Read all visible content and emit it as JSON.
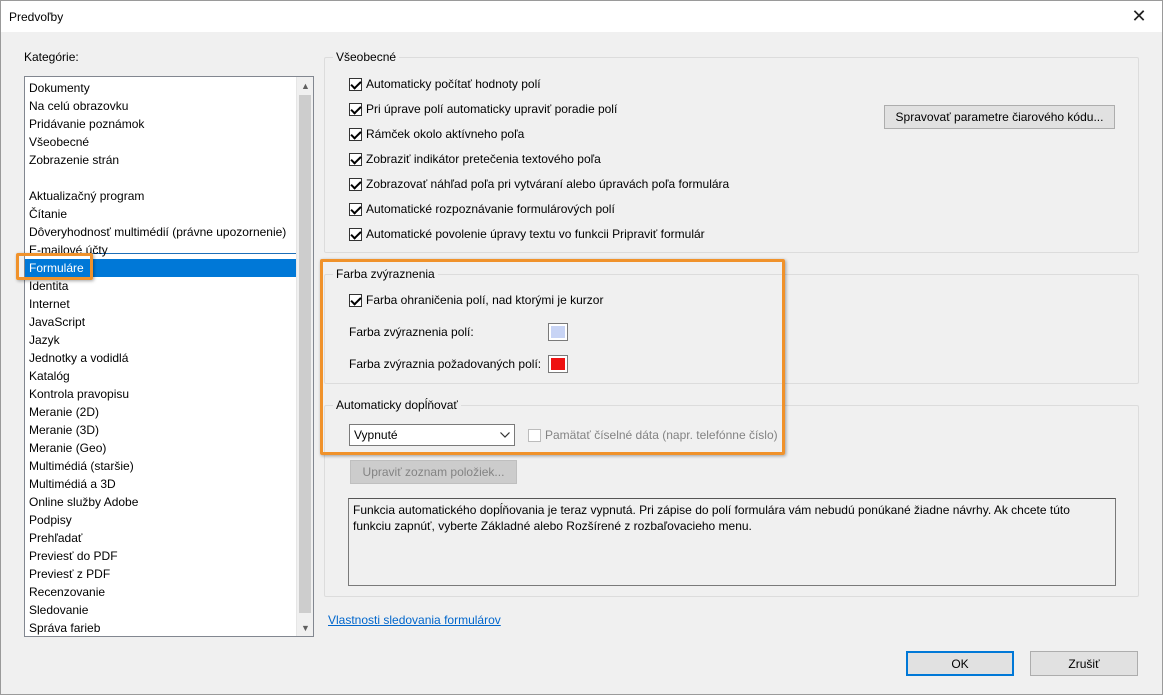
{
  "window": {
    "title": "Predvoľby"
  },
  "categories": {
    "label": "Kategórie:",
    "top_items": [
      "Dokumenty",
      "Na celú obrazovku",
      "Pridávanie poznámok",
      "Všeobecné",
      "Zobrazenie strán"
    ],
    "items": [
      "Aktualizačný program",
      "Čítanie",
      "Dôveryhodnosť multimédií (právne upozornenie)",
      "E-mailové účty",
      "Formuláre",
      "Identita",
      "Internet",
      "JavaScript",
      "Jazyk",
      "Jednotky a vodidlá",
      "Katalóg",
      "Kontrola pravopisu",
      "Meranie (2D)",
      "Meranie (3D)",
      "Meranie (Geo)",
      "Multimédiá (staršie)",
      "Multimédiá a 3D",
      "Online služby Adobe",
      "Podpisy",
      "Prehľadať",
      "Previesť do PDF",
      "Previesť z PDF",
      "Recenzovanie",
      "Sledovanie",
      "Správa farieb"
    ],
    "selected": "Formuláre"
  },
  "general": {
    "title": "Všeobecné",
    "checkboxes": [
      "Automaticky počítať hodnoty polí",
      "Pri úprave polí automaticky upraviť poradie polí",
      "Rámček okolo aktívneho poľa",
      "Zobraziť indikátor pretečenia textového poľa",
      "Zobrazovať náhľad poľa pri vytváraní alebo úpravách poľa formulára",
      "Automatické rozpoznávanie formulárových polí",
      "Automatické povolenie úpravy textu vo funkcii Pripraviť formulár"
    ],
    "barcode_button": "Spravovať parametre čiarového kódu..."
  },
  "highlight": {
    "title": "Farba zvýraznenia",
    "border_checkbox": "Farba ohraničenia polí, nad ktorými je kurzor",
    "field_color_label": "Farba zvýraznenia polí:",
    "required_color_label": "Farba zvýraznia požadovaných polí:",
    "field_color": "#c8d4f5",
    "required_color": "#ee1111"
  },
  "autocomplete": {
    "title": "Automaticky dopĺňovať",
    "mode": "Vypnuté",
    "remember_numeric": "Pamätať číselné dáta (napr. telefónne číslo)",
    "edit_list_button": "Upraviť zoznam položiek...",
    "description": "Funkcia automatického dopĺňovania je teraz vypnutá. Pri zápise do polí formulára vám nebudú ponúkané žiadne návrhy. Ak chcete túto funkciu zapnúť, vyberte Základné alebo Rozšírené z rozbaľovacieho menu."
  },
  "tracking_link": "Vlastnosti sledovania formulárov",
  "buttons": {
    "ok": "OK",
    "cancel": "Zrušiť"
  },
  "accent_color": "#f0922b"
}
